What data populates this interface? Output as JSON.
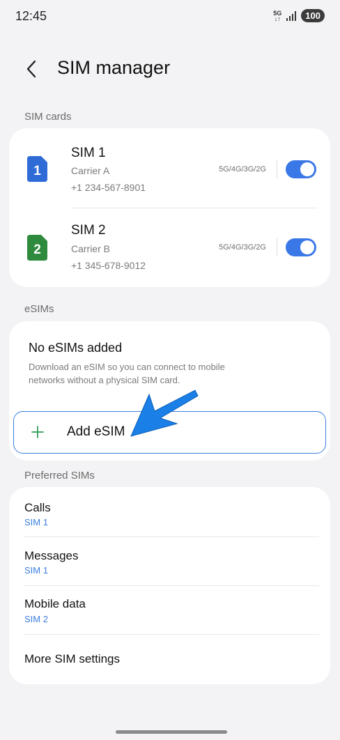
{
  "status_bar": {
    "time": "12:45",
    "net_top": "5G",
    "net_bottom": "↓↑",
    "battery": "100",
    "signal_icon": "signal-icon"
  },
  "header": {
    "title": "SIM manager",
    "back_icon": "chevron-left-icon"
  },
  "sim_section": {
    "label": "SIM cards",
    "sims": [
      {
        "name": "SIM 1",
        "carrier": "Carrier A",
        "number": "+1 234-567-8901",
        "network": "5G/4G/3G/2G",
        "badge": "1",
        "color": "#2f6bd6",
        "enabled": true
      },
      {
        "name": "SIM 2",
        "carrier": "Carrier B",
        "number": "+1 345-678-9012",
        "network": "5G/4G/3G/2G",
        "badge": "2",
        "color": "#2e8a3c",
        "enabled": true
      }
    ]
  },
  "esim_section": {
    "label": "eSIMs",
    "empty_title": "No eSIMs added",
    "empty_description": "Download an eSIM so you can connect to mobile networks without a physical SIM card.",
    "add_label": "Add eSIM"
  },
  "preferred_section": {
    "label": "Preferred SIMs",
    "items": [
      {
        "title": "Calls",
        "value": "SIM 1"
      },
      {
        "title": "Messages",
        "value": "SIM 1"
      },
      {
        "title": "Mobile data",
        "value": "SIM 2"
      }
    ],
    "more_label": "More SIM settings"
  },
  "colors": {
    "accent": "#3b7de0",
    "toggle_on": "#3b78e7",
    "plus": "#2e9c57",
    "arrow": "#1a7fe6"
  }
}
